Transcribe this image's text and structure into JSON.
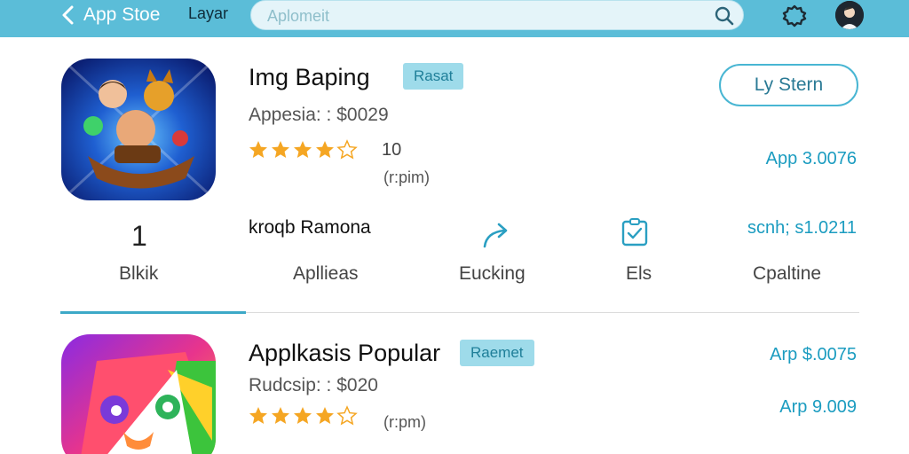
{
  "header": {
    "back_label": "App Stoe",
    "tab_label": "Layar",
    "search_placeholder": "Aplomeit",
    "bar_color": "#5bbdd8"
  },
  "featured": {
    "title": "Img Baping",
    "badge": "Rasat",
    "price_line": "Appesia: : $0029",
    "rating": 4,
    "rating_max": 5,
    "count": "10",
    "sub": "(r:pim)",
    "action_button": "Ly Stern",
    "price_link": "App 3.0076",
    "icon": "game-characters-icon"
  },
  "stats": {
    "heading": "kroqb Ramona",
    "price_link": "scnh; s1.0211",
    "items": [
      {
        "value": "1",
        "label": "Blkik"
      },
      {
        "label": "Apllieas"
      },
      {
        "label": "Eucking",
        "icon": "share-arrow-icon"
      },
      {
        "label": "Els",
        "icon": "clipboard-check-icon"
      },
      {
        "label": "Cpaltine"
      }
    ]
  },
  "popular": {
    "title": "Applkasis Popular",
    "badge": "Raemet",
    "price_line": "Rudcsip: : $020",
    "rating": 4,
    "rating_max": 5,
    "sub": "(r:pm)",
    "price_link_1": "Arp $.0075",
    "price_link_2": "Arp 9.009",
    "icon": "colorful-monster-icon"
  },
  "colors": {
    "accent": "#3da9c7",
    "star": "#f5a623",
    "badge_bg": "#9edbea"
  }
}
